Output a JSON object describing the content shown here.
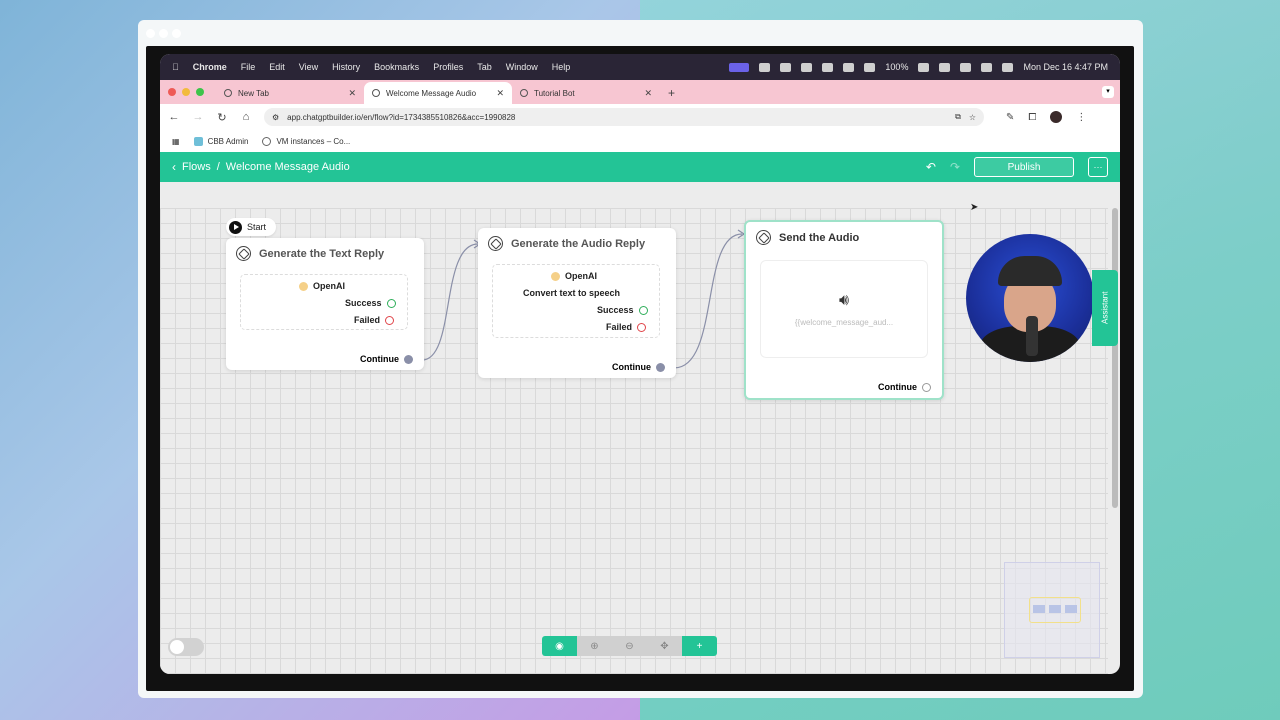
{
  "menubar": {
    "app": "Chrome",
    "menus": [
      "File",
      "Edit",
      "View",
      "History",
      "Bookmarks",
      "Profiles",
      "Tab",
      "Window",
      "Help"
    ],
    "battery": "100%",
    "datetime": "Mon Dec 16  4:47 PM"
  },
  "tabs": [
    {
      "label": "New Tab"
    },
    {
      "label": "Welcome Message Audio"
    },
    {
      "label": "Tutorial Bot"
    }
  ],
  "address": {
    "url": "app.chatgptbuilder.io/en/flow?id=1734385510826&acc=1990828"
  },
  "bookmarks": [
    {
      "label": "CBB Admin"
    },
    {
      "label": "VM instances – Co..."
    }
  ],
  "header": {
    "back_label": "Flows",
    "separator": "/",
    "title": "Welcome Message Audio",
    "publish_label": "Publish",
    "more_label": "···"
  },
  "canvas": {
    "start_label": "Start",
    "nodes": [
      {
        "title": "Generate the Text Reply",
        "provider": "OpenAI",
        "success": "Success",
        "failed": "Failed",
        "continue": "Continue"
      },
      {
        "title": "Generate the Audio Reply",
        "provider": "OpenAI",
        "action": "Convert text to speech",
        "success": "Success",
        "failed": "Failed",
        "continue": "Continue"
      },
      {
        "title": "Send the Audio",
        "variable": "{{welcome_message_aud...",
        "continue": "Continue"
      }
    ],
    "assistant_label": "Assistant"
  },
  "colors": {
    "brand_green": "#23c496",
    "tab_bar_pink": "#f7c6d2",
    "success": "#2fae5a",
    "failed": "#e0454a"
  }
}
